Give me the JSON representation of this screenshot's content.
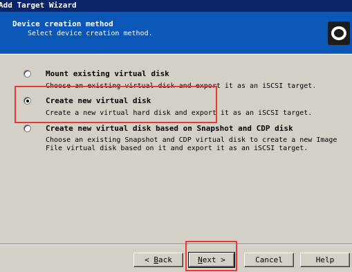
{
  "window": {
    "title": "Add Target Wizard"
  },
  "header": {
    "title": "Device creation method",
    "subtitle": "Select device creation method."
  },
  "options": [
    {
      "label": "Mount existing virtual disk",
      "desc": [
        "Choose an existing virtual disk and export it as an iSCSI target."
      ],
      "selected": false
    },
    {
      "label": "Create new virtual disk",
      "desc": [
        "Create a new virtual hard disk and export it as an iSCSI target."
      ],
      "selected": true
    },
    {
      "label": "Create new virtual disk based on Snapshot and CDP disk",
      "desc": [
        "Choose an existing Snapshot and CDP virtual disk to create a new Image",
        "File virtual disk based on it and export it as an iSCSI target."
      ],
      "selected": false
    }
  ],
  "buttons": {
    "back_prefix": "< ",
    "back_mnemonic": "B",
    "back_rest": "ack",
    "next_mnemonic": "N",
    "next_rest": "ext >",
    "cancel": "Cancel",
    "help": "Help"
  },
  "colors": {
    "header_bg": "#0b57b8",
    "titlebar_bg": "#0a246a",
    "highlight": "#e53935"
  }
}
